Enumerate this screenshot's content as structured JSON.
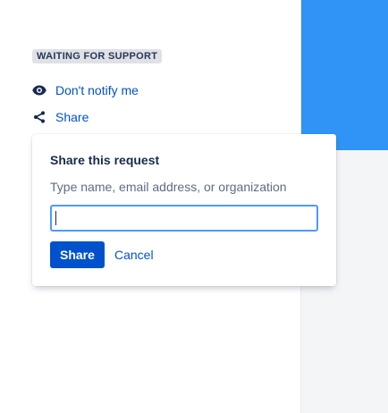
{
  "request": {
    "status": "WAITING FOR SUPPORT",
    "actions": [
      {
        "label": "Don't notify me",
        "icon": "eye-icon"
      },
      {
        "label": "Share",
        "icon": "share-icon"
      }
    ]
  },
  "share_dialog": {
    "title": "Share this request",
    "hint": "Type name, email address, or organization",
    "input_value": "",
    "share_label": "Share",
    "cancel_label": "Cancel"
  },
  "colors": {
    "accent": "#0052cc",
    "banner_blue": "#2f94f5",
    "sidebar_bg": "#f4f5f7",
    "badge_bg": "#dfe1e6",
    "focus_border": "#4c9aff"
  }
}
